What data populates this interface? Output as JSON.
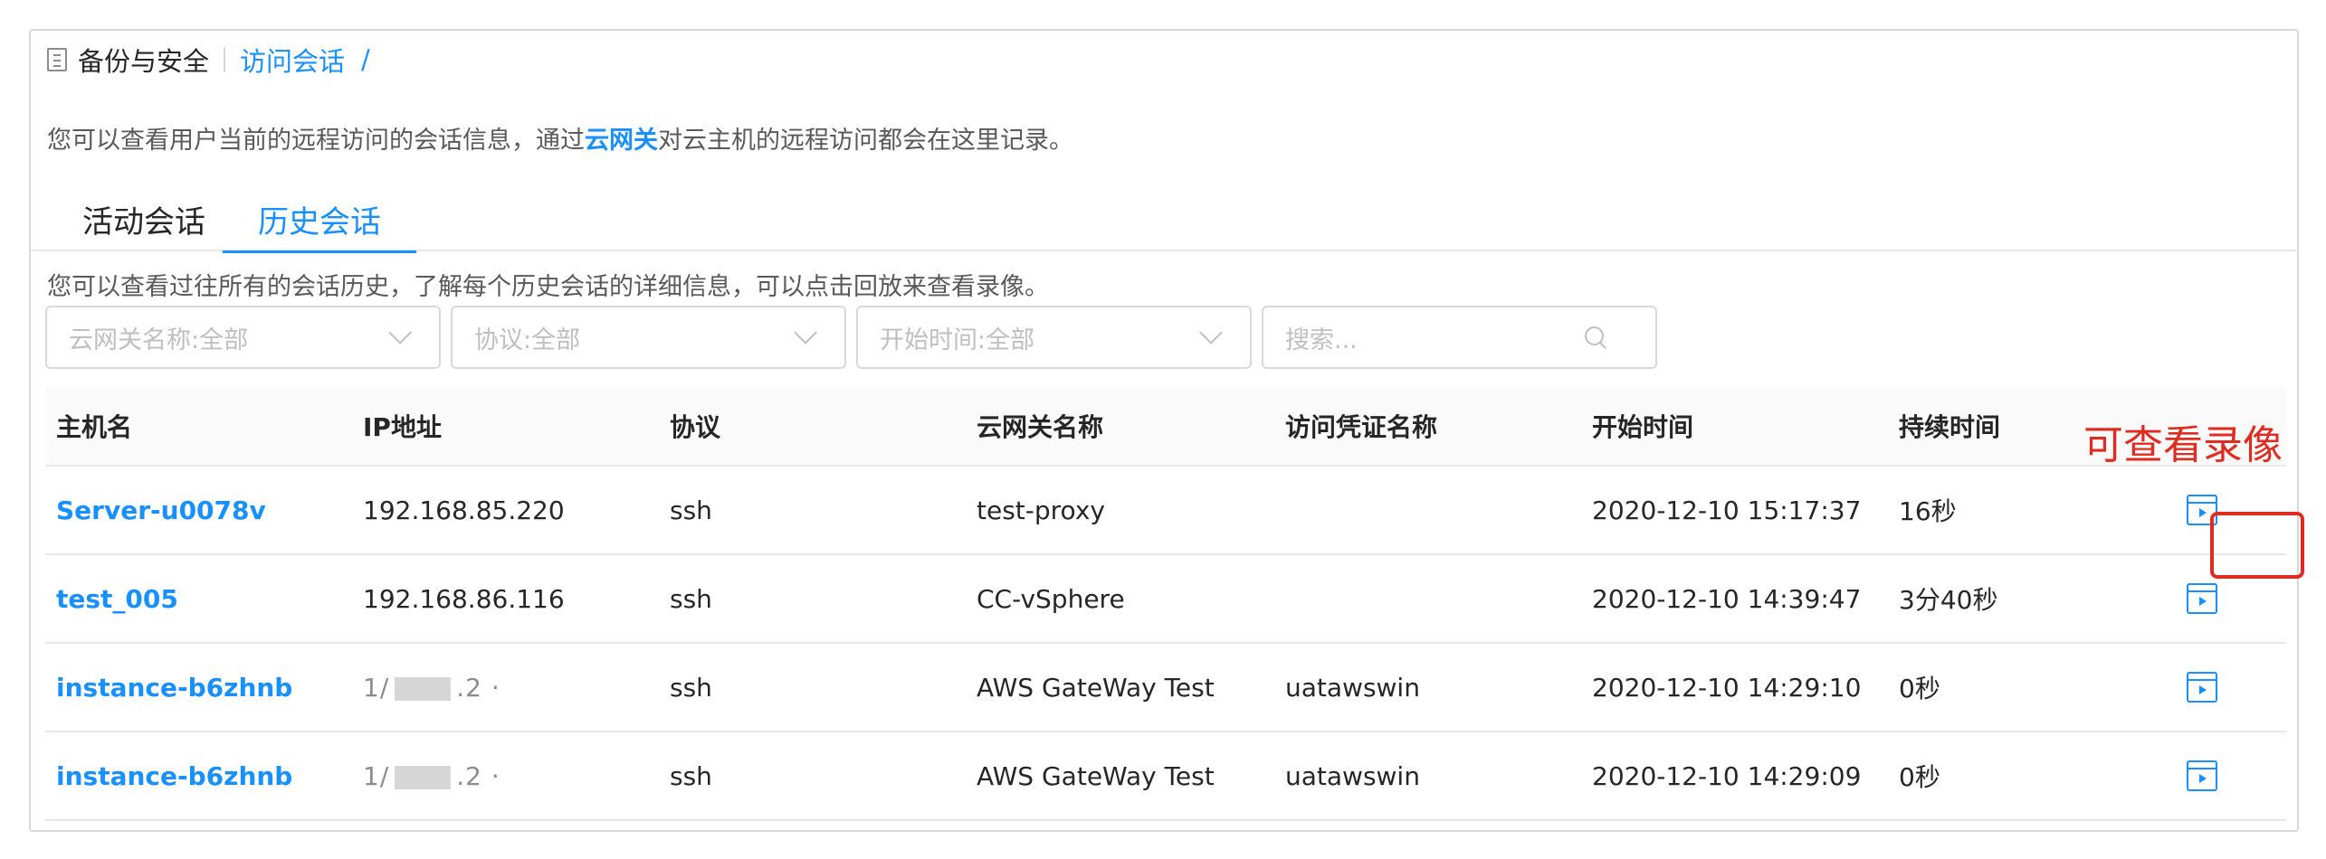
{
  "breadcrumb": {
    "root": "备份与安全",
    "current": "访问会话",
    "separator": "/"
  },
  "page_description": {
    "prefix": "您可以查看用户当前的远程访问的会话信息，通过",
    "link": "云网关",
    "suffix": "对云主机的远程访问都会在这里记录。"
  },
  "tabs": [
    {
      "label": "活动会话",
      "active": false
    },
    {
      "label": "历史会话",
      "active": true
    }
  ],
  "history_description": "您可以查看过往所有的会话历史，了解每个历史会话的详细信息，可以点击回放来查看录像。",
  "filters": {
    "gateway_name": "云网关名称:全部",
    "protocol": "协议:全部",
    "start_time": "开始时间:全部",
    "search_placeholder": "搜索..."
  },
  "table": {
    "columns": [
      "主机名",
      "IP地址",
      "协议",
      "云网关名称",
      "访问凭证名称",
      "开始时间",
      "持续时间"
    ],
    "rows": [
      {
        "hostname": "Server-u0078v",
        "ip": "192.168.85.220",
        "protocol": "ssh",
        "gateway": "test-proxy",
        "credential": "",
        "start_time": "2020-12-10 15:17:37",
        "duration": "16秒"
      },
      {
        "hostname": "test_005",
        "ip": "192.168.86.116",
        "protocol": "ssh",
        "gateway": "CC-vSphere",
        "credential": "",
        "start_time": "2020-12-10 14:39:47",
        "duration": "3分40秒"
      },
      {
        "hostname": "instance-b6zhnb",
        "ip_prefix": "1/",
        "ip_suffix": ".2 ·",
        "protocol": "ssh",
        "gateway": "AWS GateWay Test",
        "credential": "uatawswin",
        "start_time": "2020-12-10 14:29:10",
        "duration": "0秒"
      },
      {
        "hostname": "instance-b6zhnb",
        "ip_prefix": "1/",
        "ip_suffix": ".2 ·",
        "protocol": "ssh",
        "gateway": "AWS GateWay Test",
        "credential": "uatawswin",
        "start_time": "2020-12-10 14:29:09",
        "duration": "0秒"
      }
    ]
  },
  "annotation": "可查看录像",
  "colors": {
    "accent": "#1890ff",
    "annotation_red": "#e02b20",
    "border": "#d9d9d9",
    "header_bg": "#fafafa"
  },
  "icons": {
    "breadcrumb": "document-icon",
    "filter_dropdown": "chevron-down-icon",
    "search": "search-icon",
    "playback": "video-playback-icon"
  }
}
